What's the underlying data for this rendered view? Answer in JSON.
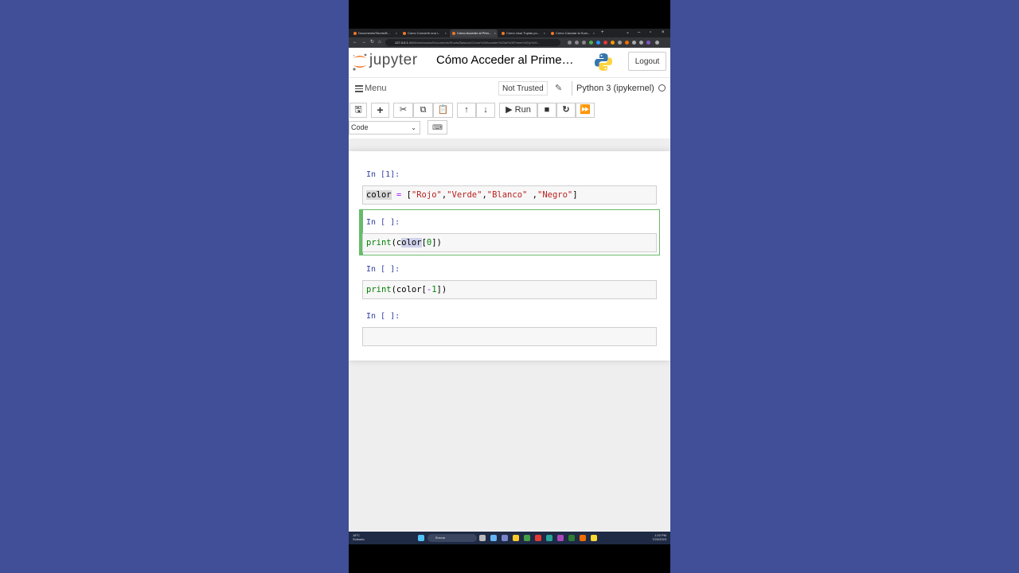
{
  "browser": {
    "tabs": [
      {
        "label": "Documents/Shorts/B..."
      },
      {
        "label": "Cómo Convertir una l..."
      },
      {
        "label": "Cómo Acceder al Prim..."
      },
      {
        "label": "Cómo Usar Tuplas po..."
      },
      {
        "label": "Cómo Calcular la Sum..."
      }
    ],
    "new_tab": "+",
    "url_host": "127.0.0.1",
    "url_rest": ":8888/notebooks/Documents/Shorts/Basicos/Cómo%20Acceder%20al%20Primer%20y%20..."
  },
  "jupyter": {
    "logo_text": "jupyter",
    "notebook_title": "Cómo Acceder al Prime…",
    "logout_label": "Logout",
    "menu_label": "Menu",
    "not_trusted_label": "Not Trusted",
    "kernel_name": "Python 3 (ipykernel)",
    "run_label": "Run",
    "cell_type": "Code"
  },
  "cells": [
    {
      "prompt": "In [1]:"
    },
    {
      "prompt": "In [ ]:"
    },
    {
      "prompt": "In [ ]:"
    },
    {
      "prompt": "In [ ]:"
    }
  ],
  "code": {
    "c1": {
      "var": "color",
      "eq": " = ",
      "lb": "[",
      "s1": "\"Rojo\"",
      "s2": "\"Verde\"",
      "s3": "\"Blanco\"",
      "s4": "\"Negro\"",
      "comma": ",",
      "spc": " ",
      "rb": "]"
    },
    "c2": {
      "fn": "print",
      "a": "(c",
      "b": "olor",
      "c": "[",
      "n": "0",
      "d": "])"
    },
    "c3": {
      "fn": "print",
      "a": "(color[",
      "op": "-",
      "n": "1",
      "d": "])"
    }
  },
  "taskbar": {
    "weather_temp": "18°C",
    "weather_desc": "Soleado",
    "search_label": "Buscar",
    "time": "1:20 PM",
    "date": "7/20/2023"
  },
  "colors": {
    "background": "#404f97",
    "jupyter_orange": "#f37726",
    "selected_cell": "#66bb6a",
    "prompt_blue": "#303f9f"
  }
}
